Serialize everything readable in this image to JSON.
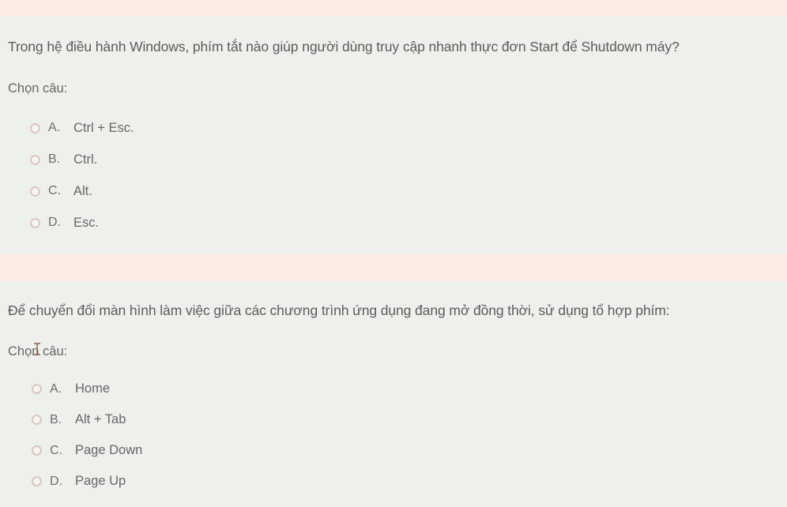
{
  "questions": [
    {
      "text": "Trong hệ điều hành Windows, phím tắt nào giúp người dùng truy cập nhanh thực đơn Start để Shutdown máy?",
      "prompt": "Chọn câu:",
      "options": [
        {
          "letter": "A.",
          "text": "Ctrl + Esc."
        },
        {
          "letter": "B.",
          "text": "Ctrl."
        },
        {
          "letter": "C.",
          "text": "Alt."
        },
        {
          "letter": "D.",
          "text": "Esc."
        }
      ]
    },
    {
      "text": "Để chuyển đổi màn hình làm việc giữa các chương trình ứng dụng đang mở đồng thời, sử dụng tổ hợp phím:",
      "prompt": "Chọn câu:",
      "options": [
        {
          "letter": "A.",
          "text": "Home"
        },
        {
          "letter": "B.",
          "text": "Alt + Tab"
        },
        {
          "letter": "C.",
          "text": "Page Down"
        },
        {
          "letter": "D.",
          "text": "Page Up"
        }
      ]
    }
  ],
  "colors": {
    "band": "#fbece3",
    "card": "#eef0ec",
    "text": "#5a5d5c",
    "radio_border": "#d6c8c0"
  },
  "cursor": {
    "icon": "text-cursor-icon"
  }
}
